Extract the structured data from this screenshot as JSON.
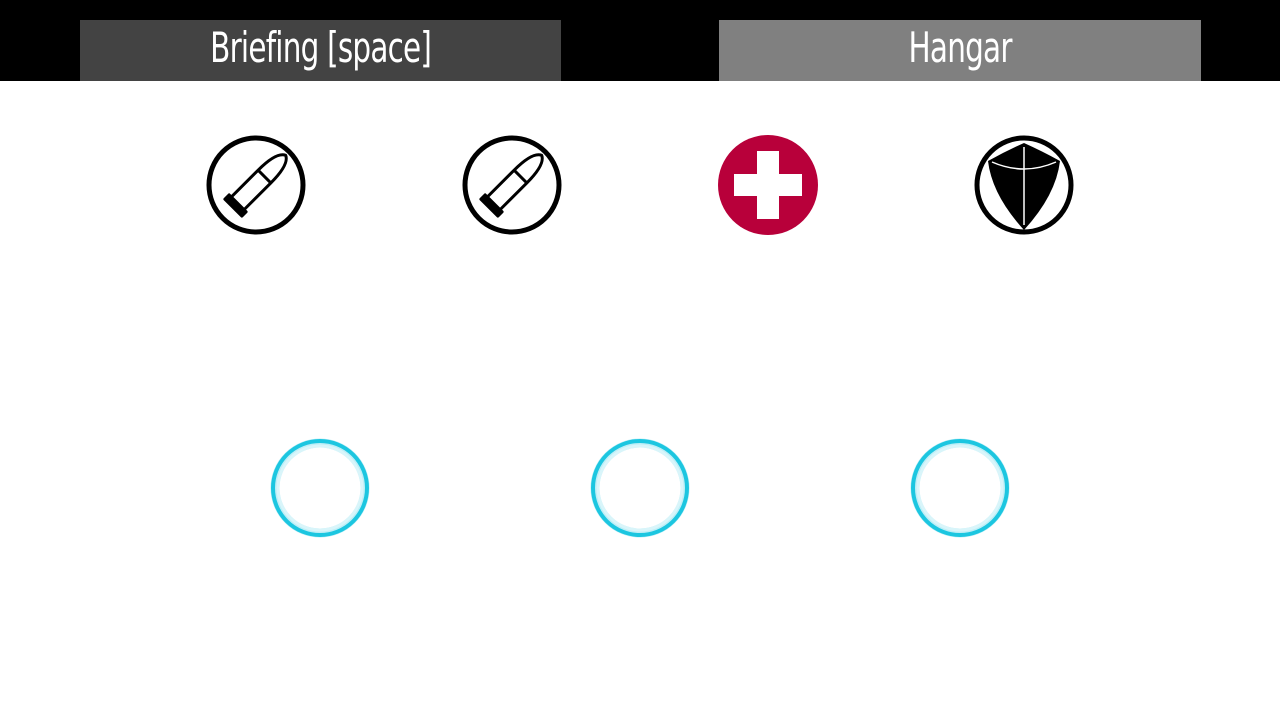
{
  "tabs": {
    "briefing": {
      "label": "Briefing [space]",
      "background": "#434343"
    },
    "hangar": {
      "label": "Hangar",
      "background": "#808080"
    }
  },
  "items": [
    {
      "icon": "bullet-icon"
    },
    {
      "icon": "bullet-icon"
    },
    {
      "icon": "medkit-cross-icon",
      "color": "#b8003a"
    },
    {
      "icon": "shield-icon"
    }
  ],
  "empty_slots": [
    {
      "icon": "empty-slot-ring-icon",
      "color": "#1cc6e0"
    },
    {
      "icon": "empty-slot-ring-icon",
      "color": "#1cc6e0"
    },
    {
      "icon": "empty-slot-ring-icon",
      "color": "#1cc6e0"
    }
  ]
}
